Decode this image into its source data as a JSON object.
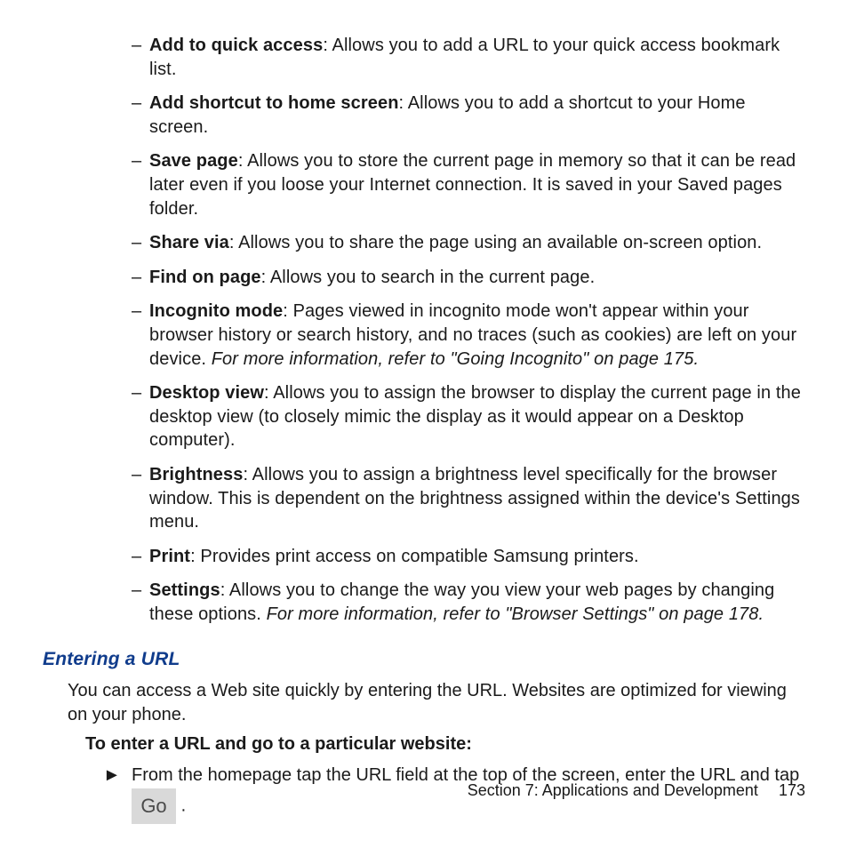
{
  "defs": [
    {
      "term": "Add to quick access",
      "desc": ": Allows you to add a URL to your quick access bookmark list."
    },
    {
      "term": "Add shortcut to home screen",
      "desc": ": Allows you to add a shortcut to your Home screen."
    },
    {
      "term": "Save page",
      "desc": ": Allows you to store the current page in memory so that it can be read later even if you loose your Internet connection. It is saved in your Saved pages folder."
    },
    {
      "term": "Share via",
      "desc": ": Allows you to share the page using an available on-screen option."
    },
    {
      "term": "Find on page",
      "desc": ": Allows you to search in the current page."
    },
    {
      "term": "Incognito mode",
      "desc": ": Pages viewed in incognito mode won't appear within your browser history or search history, and no traces (such as cookies) are left on your device. ",
      "xref": "For more information, refer to \"Going Incognito\" on page 175."
    },
    {
      "term": "Desktop view",
      "desc": ": Allows you to assign the browser to display the current page in the desktop view (to closely mimic the display as it would appear on a Desktop computer)."
    },
    {
      "term": "Brightness",
      "desc": ": Allows you to assign a brightness level specifically for the browser window. This is dependent on the brightness assigned within the device's Settings menu."
    },
    {
      "term": "Print",
      "desc": ": Provides print access on compatible Samsung printers."
    },
    {
      "term": "Settings",
      "desc": ": Allows you to change the way you view your web pages by changing these options. ",
      "xref": "For more information, refer to \"Browser Settings\" on page 178."
    }
  ],
  "heading": "Entering a URL",
  "intro": "You can access a Web site quickly by entering the URL. Websites are optimized for viewing on your phone.",
  "sub_heading": "To enter a URL and go to a particular website:",
  "step": {
    "arrow": "►",
    "before": "From the homepage tap the URL field at the top of the screen, enter the URL and tap ",
    "button": "Go",
    "after": " ."
  },
  "footer": {
    "section": "Section 7:  Applications and Development",
    "page": "173"
  },
  "dash": "–"
}
